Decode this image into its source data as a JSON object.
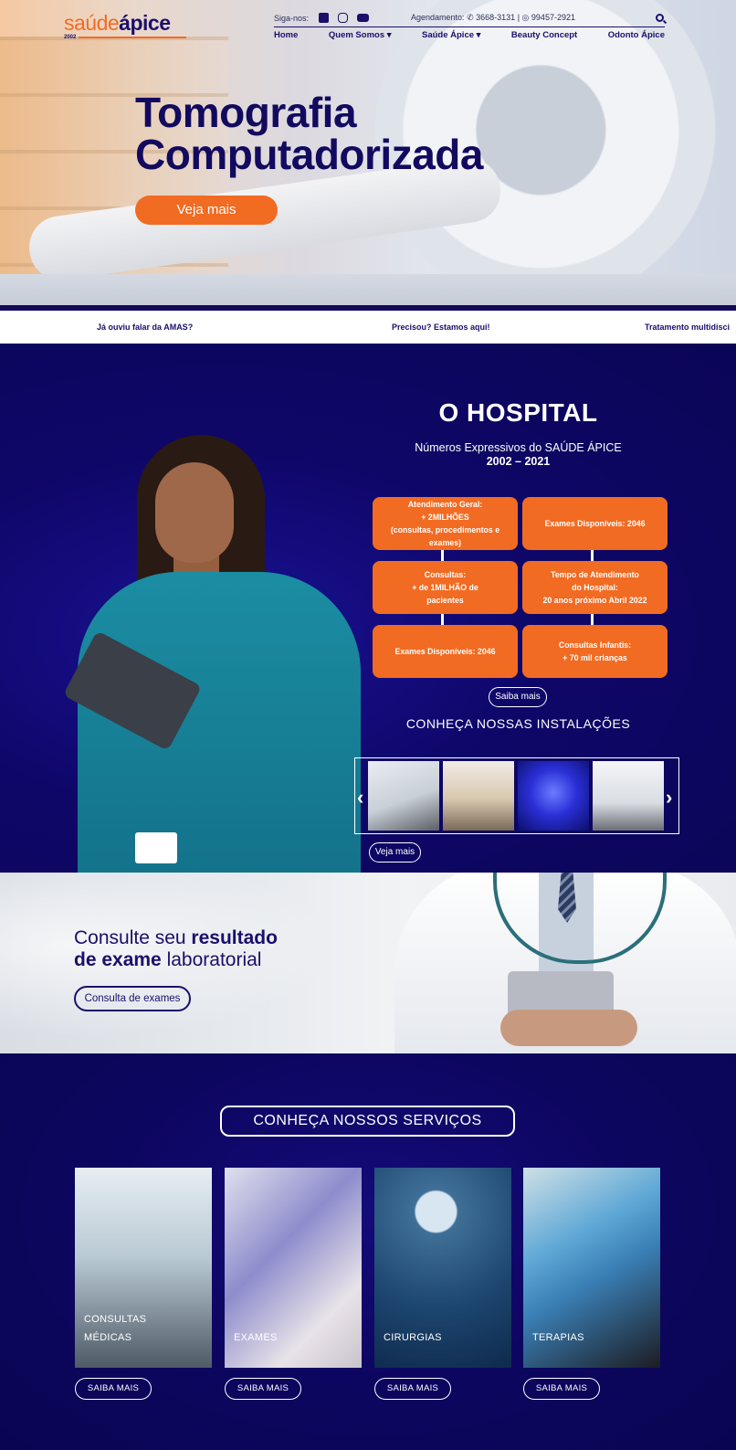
{
  "header": {
    "logo_part1": "saúde",
    "logo_part2": "ápice",
    "logo_year": "2002",
    "follow_label": "Siga-nos:",
    "social_icons": [
      "facebook-icon",
      "instagram-icon",
      "youtube-icon"
    ],
    "schedule_label": "Agendamento:",
    "phone": "3668-3131",
    "separator": "|",
    "whatsapp": "99457-2921",
    "nav": [
      "Home",
      "Quem Somos ▾",
      "Saúde Ápice ▾",
      "Beauty Concept",
      "Odonto Ápice"
    ]
  },
  "hero": {
    "title_line1": "Tomografia",
    "title_line2": "Computadorizada",
    "cta": "Veja mais"
  },
  "ticker": [
    "Já ouviu falar da AMAS?",
    "Precisou? Estamos aqui!",
    "Tratamento multidisci"
  ],
  "hospital": {
    "title": "O HOSPITAL",
    "subtitle": "Números Expressivos do SAÚDE ÁPICE",
    "years": "2002 – 2021",
    "stats": [
      "Atendimento Geral:\n+ 2MILHÕES\n(consultas, procedimentos e\nexames)",
      "Exames Disponíveis: 2046",
      "Consultas:\n+ de 1MILHÃO de\npacientes",
      "Tempo de Atendimento\ndo Hospital:\n20 anos próximo Abril 2022",
      "Exames Disponíveis: 2046",
      "Consultas Infantis:\n+ 70 mil crianças"
    ],
    "more_label": "Saiba mais",
    "installations_title": "CONHEÇA NOSSAS INSTALAÇÕES",
    "gallery_more": "Veja mais"
  },
  "exam": {
    "line1_regular": "Consulte seu ",
    "line1_bold": "resultado",
    "line2_bold": "de exame",
    "line2_regular": " laboratorial",
    "cta": "Consulta de exames"
  },
  "services": {
    "title": "CONHEÇA NOSSOS SERVIÇOS",
    "cards": [
      {
        "label": "CONSULTAS\nMÉDICAS",
        "button": "SAIBA MAIS"
      },
      {
        "label": "EXAMES",
        "button": "SAIBA MAIS"
      },
      {
        "label": "CIRURGIAS",
        "button": "SAIBA MAIS"
      },
      {
        "label": "TERAPIAS",
        "button": "SAIBA MAIS"
      }
    ]
  },
  "colors": {
    "brand_orange": "#f26b22",
    "brand_navy": "#1a0f6b",
    "section_bg": "#0d0660"
  }
}
